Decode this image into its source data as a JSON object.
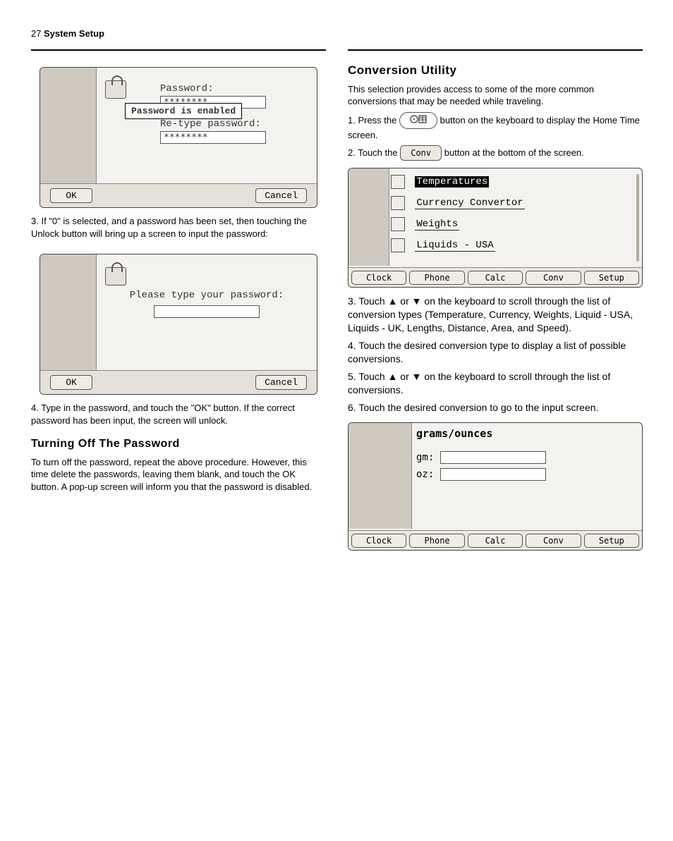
{
  "page_number": "27",
  "header": "System Setup",
  "dialog1": {
    "password_label": "Password:",
    "password_value": "********",
    "retype_label": "Re-type password:",
    "retype_value": "********",
    "popup": "Password is enabled",
    "ok": "OK",
    "cancel": "Cancel"
  },
  "left_text1": "3. If \"0\" is selected, and a password has been set, then touching the Unlock button will bring up a screen to input the password:",
  "dialog2": {
    "prompt": "Please type your password:",
    "ok": "OK",
    "cancel": "Cancel"
  },
  "left_text2": "4. Type in the password, and touch the \"OK\" button. If the correct password has been input, the screen will unlock.",
  "left_heading": "Turning Off The Password",
  "left_text3": "To turn off the password, repeat the above procedure. However, this time delete the passwords, leaving them blank, and touch the OK button. A pop-up screen will inform you that the password is disabled.",
  "right_h2": "Conversion Utility",
  "right_p1": "This selection provides access to some of the more common conversions that may be needed while traveling.",
  "right_p2_a": "1. Press the",
  "right_p2_b": "button on the keyboard to display the Home Time screen.",
  "right_p3_a": "2. Touch the",
  "right_p3_b": "button at the bottom of the screen.",
  "conv_badge": "Conv",
  "list_items": [
    "Temperatures",
    "Currency Convertor",
    "Weights",
    "Liquids - USA"
  ],
  "tabs": [
    "Clock",
    "Phone",
    "Calc",
    "Conv",
    "Setup"
  ],
  "right_p4_a": "3. Touch ",
  "right_p4_b": " or ",
  "right_p4_c": " on the keyboard to scroll through the list of conversion types (Temperature, Currency, Weights, Liquid - USA, Liquids - UK, Lengths, Distance, Area, and Speed).",
  "right_p5": "4. Touch the desired conversion type to display a list of possible conversions.",
  "right_p6_a": "5. Touch ",
  "right_p6_b": " or ",
  "right_p6_c": " on the keyboard to scroll through the list of conversions.",
  "right_p7": "6. Touch the desired conversion to go to the input screen.",
  "conv_title": "grams/ounces",
  "conv_gm_label": "gm:",
  "conv_oz_label": "oz:",
  "conv_gm_val": " ",
  "conv_oz_val": ""
}
